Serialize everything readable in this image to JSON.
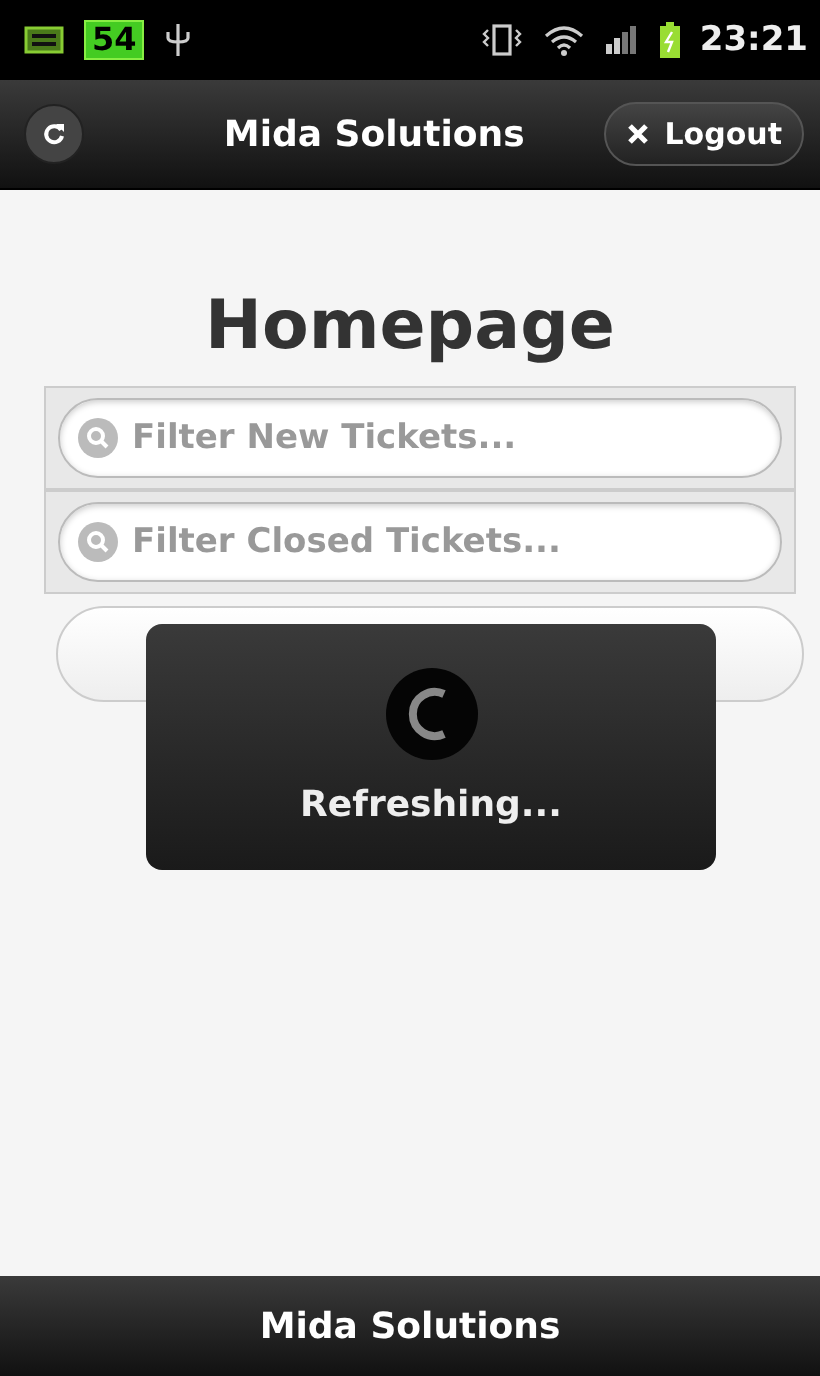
{
  "status_bar": {
    "battery": "54",
    "time": "23:21"
  },
  "header": {
    "title": "Mida Solutions",
    "logout_button": "Logout"
  },
  "page": {
    "heading": "Homepage",
    "filters": [
      {
        "placeholder": "Filter New Tickets..."
      },
      {
        "placeholder": "Filter Closed Tickets..."
      }
    ],
    "loading": {
      "message": "Refreshing..."
    }
  },
  "footer": {
    "title": "Mida Solutions"
  }
}
